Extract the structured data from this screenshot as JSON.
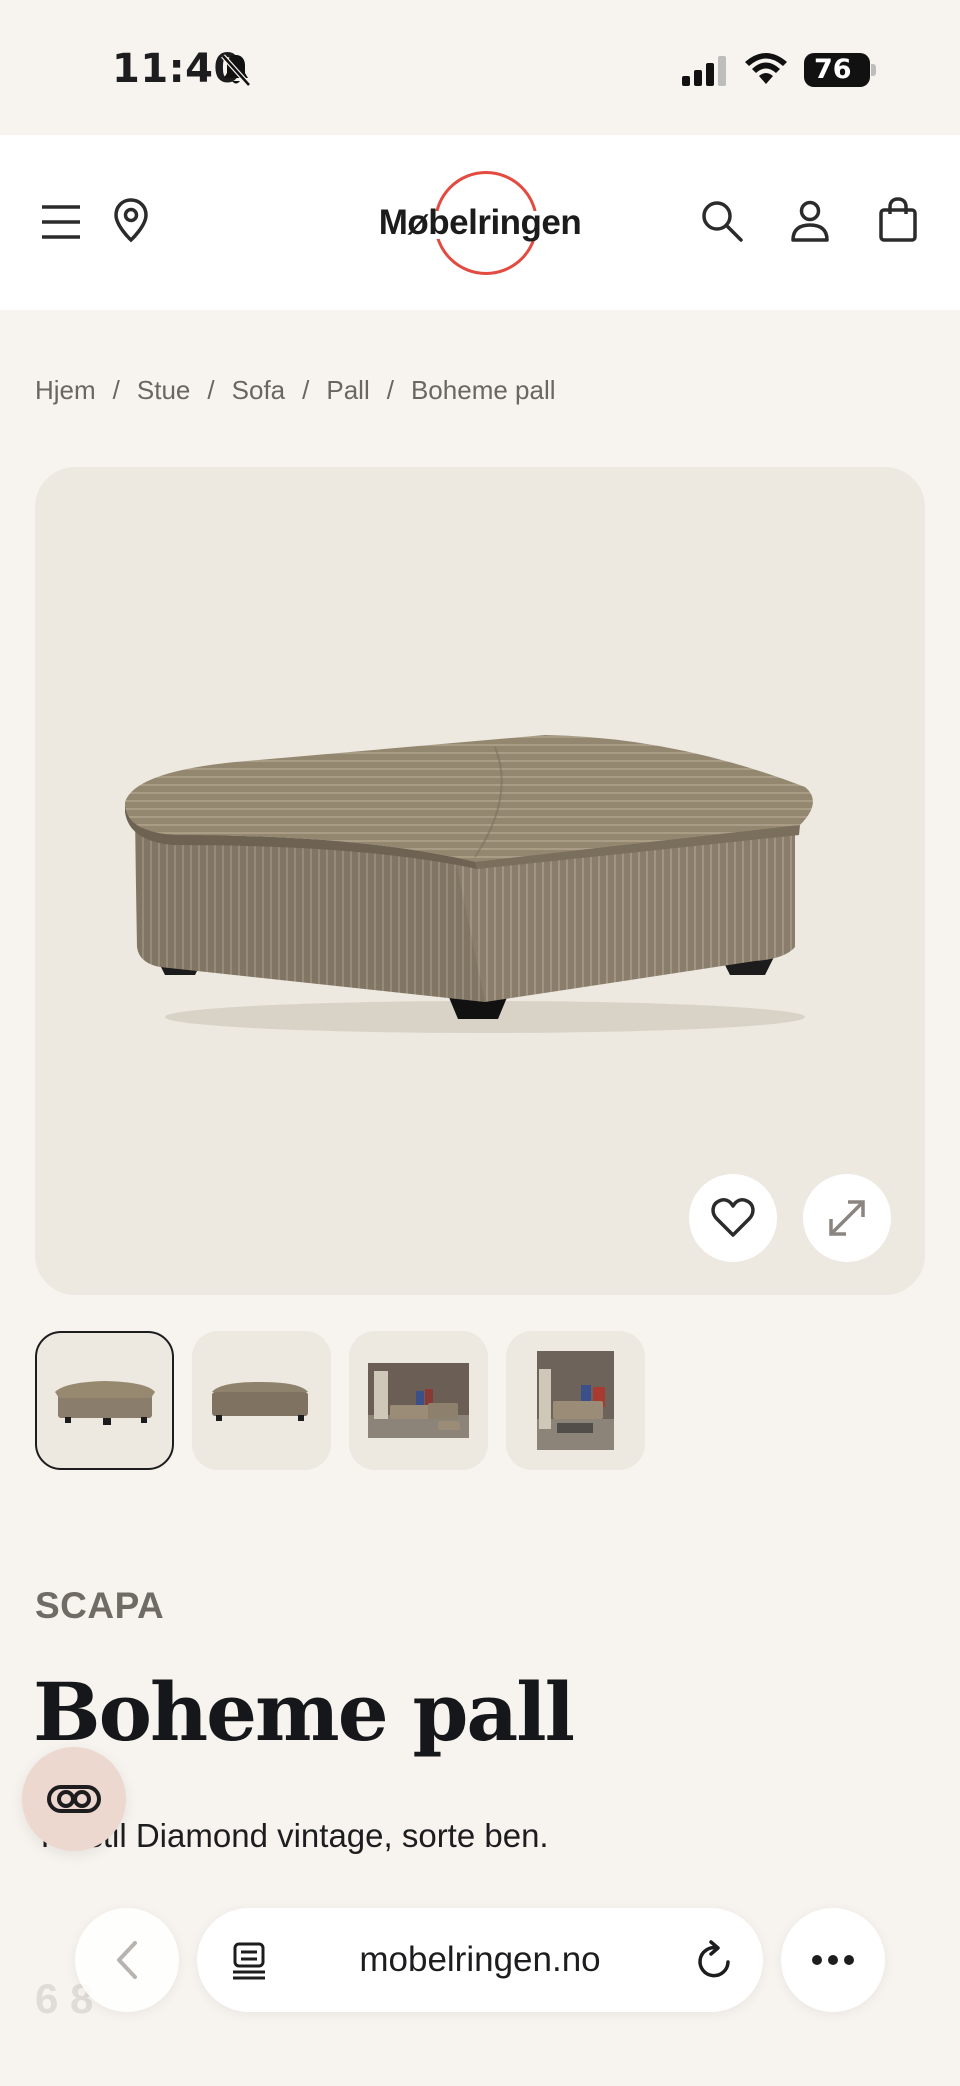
{
  "status_bar": {
    "time": "11:40",
    "battery": "76"
  },
  "header": {
    "logo_text": "Møbelringen"
  },
  "breadcrumb": [
    "Hjem",
    "Stue",
    "Sofa",
    "Pall",
    "Boheme pall"
  ],
  "product": {
    "brand": "SCAPA",
    "title": "Boheme pall",
    "description": "Tekstil Diamond vintage, sorte ben.",
    "price": "6 8",
    "image_count": 4,
    "selected_thumbnail": 1
  },
  "browser": {
    "url": "mobelringen.no"
  },
  "colors": {
    "background": "#f7f3ef",
    "header_bg": "#ffffff",
    "image_bg": "#ede8e0",
    "logo_ring": "#e34b41",
    "text_primary": "#15171a",
    "brand_text": "#716b66"
  }
}
